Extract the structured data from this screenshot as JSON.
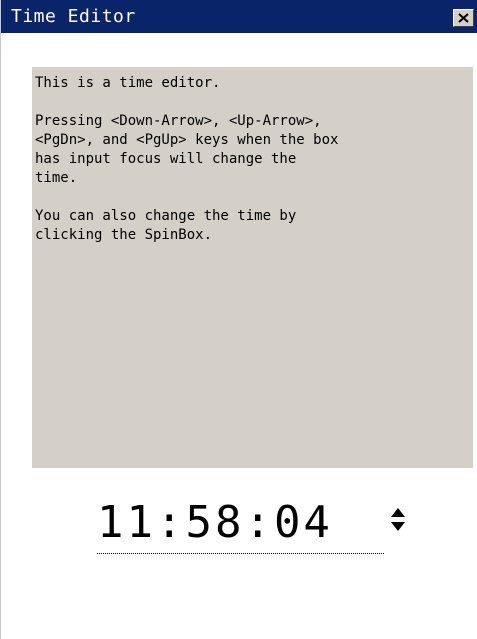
{
  "window": {
    "title": "Time Editor",
    "close_icon": "close-icon",
    "colors": {
      "title_bar": "#0a246a",
      "panel": "#d4d0c8"
    }
  },
  "info": {
    "paragraphs": [
      "This is a time editor.",
      "Pressing <Down-Arrow>, <Up-Arrow>,\n<PgDn>, and <PgUp> keys when the box\nhas input focus will change the\ntime.",
      "You can also change the time by\nclicking the SpinBox."
    ]
  },
  "time_editor": {
    "value": "11:58:04",
    "spin_icon": "spin-updown-icon"
  }
}
